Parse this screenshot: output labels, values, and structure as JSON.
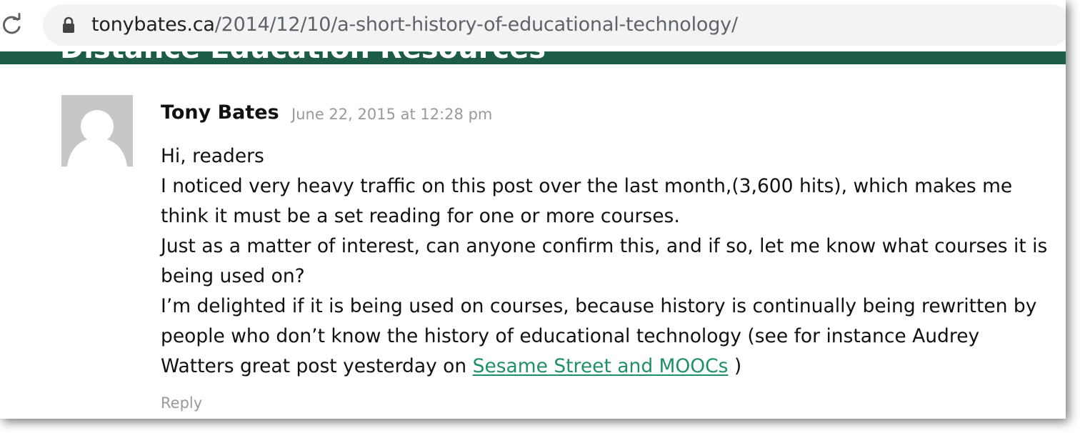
{
  "browser": {
    "url_host": "tonybates.ca",
    "url_path": "/2014/12/10/a-short-history-of-educational-technology/",
    "reload_icon": "reload-icon",
    "lock_icon": "lock-icon"
  },
  "site": {
    "header_partial_title": "Distance Education Resources",
    "band_color": "#1d5c47"
  },
  "comment": {
    "avatar_icon": "default-avatar-icon",
    "author": "Tony Bates",
    "date": "June 22, 2015 at 12:28 pm",
    "paragraphs": [
      "Hi, readers",
      "I noticed very heavy traffic on this post over the last month,(3,600 hits), which makes me think it must be a set reading for one or more courses.",
      "Just as a matter of interest, can anyone confirm this, and if so, let me know what courses it is being used on?"
    ],
    "last_paragraph_before_link": "I’m delighted if it is being used on courses, because history is continually being rewritten by people who don’t know the history of educational technology (see for instance Audrey Watters great post yesterday on ",
    "link_text": "Sesame Street and MOOCs",
    "last_paragraph_after_link": " )",
    "link_color": "#1f8f6a",
    "reply_label": "Reply"
  }
}
